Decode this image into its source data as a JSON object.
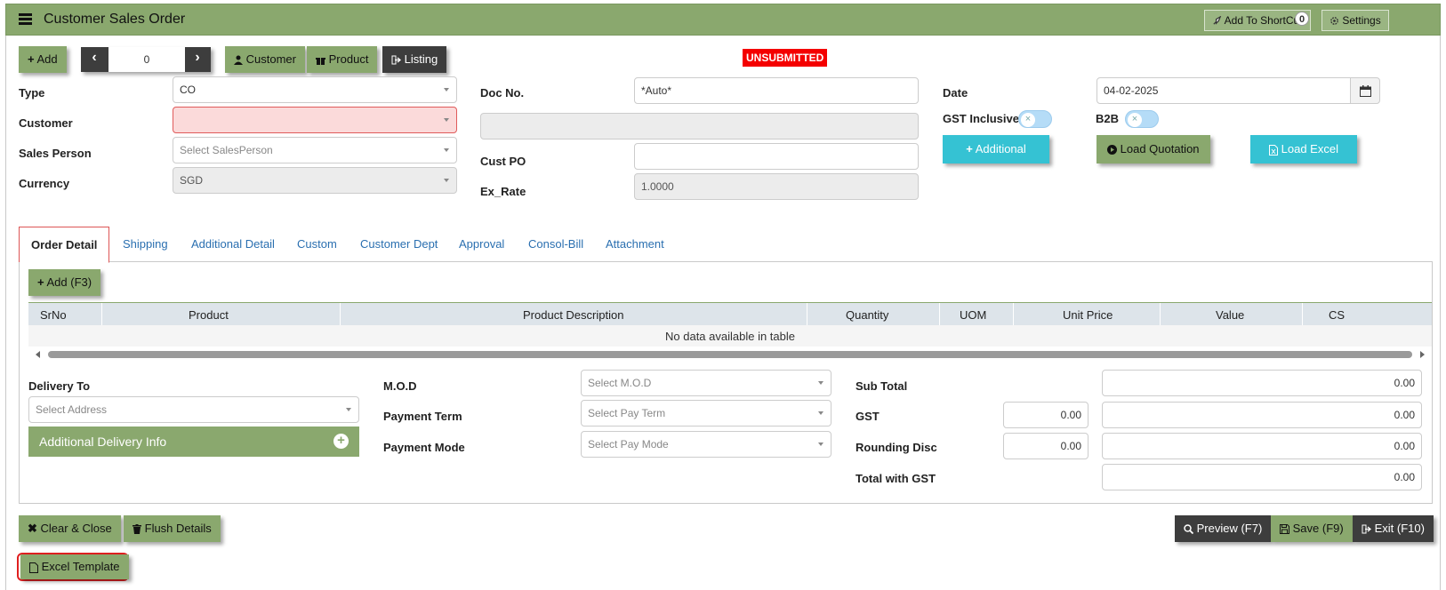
{
  "header": {
    "title": "Customer Sales Order",
    "shortcut_label": "Add To ShortCut",
    "shortcut_count": "0",
    "settings_label": "Settings"
  },
  "toolbar": {
    "add_label": "Add",
    "record_index": "0",
    "customer_label": "Customer",
    "product_label": "Product",
    "listing_label": "Listing"
  },
  "status": "UNSUBMITTED",
  "form": {
    "type_label": "Type",
    "type_value": "CO",
    "customer_label": "Customer",
    "customer_value": "",
    "sales_person_label": "Sales Person",
    "sales_person_placeholder": "Select SalesPerson",
    "currency_label": "Currency",
    "currency_value": "SGD",
    "doc_no_label": "Doc No.",
    "doc_no_value": "*Auto*",
    "customer_name_value": "",
    "cust_po_label": "Cust PO",
    "cust_po_value": "",
    "ex_rate_label": "Ex_Rate",
    "ex_rate_value": "1.0000",
    "date_label": "Date",
    "date_value": "04-02-2025",
    "gst_inclusive_label": "GST Inclusive",
    "b2b_label": "B2B",
    "additional_label": "Additional",
    "load_quotation_label": "Load Quotation",
    "load_excel_label": "Load Excel"
  },
  "tabs": [
    "Order Detail",
    "Shipping",
    "Additional Detail",
    "Custom",
    "Customer Dept",
    "Approval",
    "Consol-Bill",
    "Attachment"
  ],
  "order_detail": {
    "add_label": "Add (F3)",
    "columns": [
      "SrNo",
      "Product",
      "Product Description",
      "Quantity",
      "UOM",
      "Unit Price",
      "Value",
      "CS"
    ],
    "empty_message": "No data available in table"
  },
  "delivery": {
    "delivery_to_label": "Delivery To",
    "address_placeholder": "Select Address",
    "additional_info_label": "Additional Delivery Info",
    "mod_label": "M.O.D",
    "mod_placeholder": "Select M.O.D",
    "payment_term_label": "Payment Term",
    "payment_term_placeholder": "Select Pay Term",
    "payment_mode_label": "Payment Mode",
    "payment_mode_placeholder": "Select Pay Mode"
  },
  "totals": {
    "sub_total_label": "Sub Total",
    "sub_total_value": "0.00",
    "gst_label": "GST",
    "gst_rate": "0.00",
    "gst_value": "0.00",
    "rounding_label": "Rounding Disc",
    "rounding_rate": "0.00",
    "rounding_value": "0.00",
    "total_label": "Total with GST",
    "total_value": "0.00"
  },
  "footer": {
    "clear_close_label": "Clear & Close",
    "flush_label": "Flush Details",
    "excel_template_label": "Excel Template",
    "preview_label": "Preview (F7)",
    "save_label": "Save (F9)",
    "exit_label": "Exit (F10)"
  },
  "colors": {
    "brand_green": "#8aa86e",
    "cyan": "#35c2d3",
    "dark": "#3d3d3d",
    "status_red": "#f40000"
  }
}
